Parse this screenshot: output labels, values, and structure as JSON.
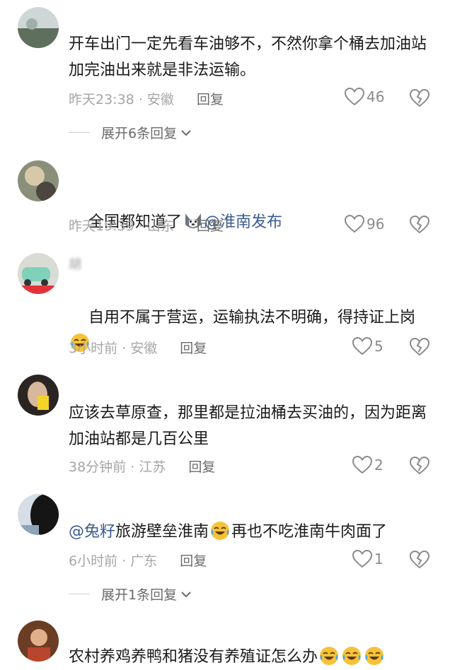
{
  "comments": [
    {
      "username": "",
      "text": "开车出门一定先看车油够不，不然你拿个桶去加油站加完油出来就是非法运输。",
      "time": "昨天23:38",
      "location": "安徽",
      "reply": "回复",
      "likes": "46",
      "expand": "展开6条回复"
    },
    {
      "username": "",
      "text_before": "全国都知道了",
      "mention": "@淮南发布",
      "time": "昨天19:39",
      "location": "山东",
      "reply": "回复",
      "likes": "96"
    },
    {
      "username": "胡",
      "text": "自用不属于营运，运输执法不明确，得持证上岗",
      "time": "3小时前",
      "location": "安徽",
      "reply": "回复",
      "likes": "5"
    },
    {
      "username": "",
      "text": "应该去草原查，那里都是拉油桶去买油的，因为距离加油站都是几百公里",
      "time": "38分钟前",
      "location": "江苏",
      "reply": "回复",
      "likes": "2"
    },
    {
      "username": "",
      "mention": "@兔籽",
      "text_mid": "旅游壁垒淮南",
      "text_after": "再也不吃淮南牛肉面了",
      "time": "6小时前",
      "location": "广东",
      "reply": "回复",
      "likes": "1",
      "expand": "展开1条回复"
    },
    {
      "username": "",
      "text": "农村养鸡养鸭和猪没有养殖证怎么办"
    }
  ],
  "meta_separator": "·",
  "icons": {
    "like": "heart-outline-icon",
    "dislike": "broken-heart-icon",
    "expand": "chevron-down-icon",
    "emoji_laugh": "laugh-cry-emoji",
    "emoji_dog": "husky-emoji"
  },
  "colors": {
    "mention": "#3b5b8f",
    "meta": "#a6a6a6",
    "text": "#1a1a1a"
  }
}
